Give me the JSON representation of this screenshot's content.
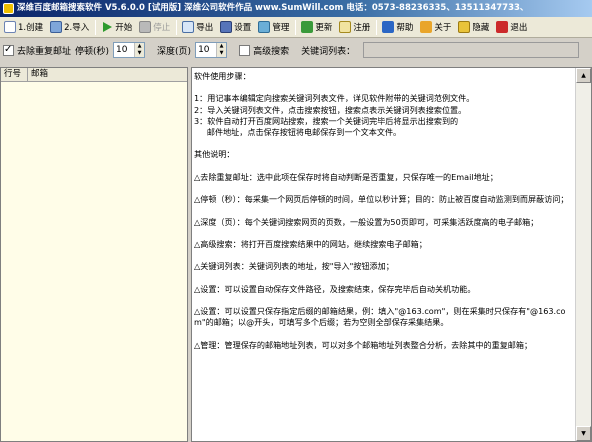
{
  "window": {
    "title": "深维百度邮箱搜索软件 V5.6.0.0 [试用版] 深维公司软件作品 www.SumWill.com 电话：0573-88236335、13511347733、"
  },
  "toolbar": {
    "items": [
      {
        "label": "1.创建",
        "icon": "new-file-icon",
        "enabled": true
      },
      {
        "label": "2.导入",
        "icon": "import-icon",
        "enabled": true
      },
      {
        "label": "开始",
        "icon": "play-icon",
        "enabled": true
      },
      {
        "label": "停止",
        "icon": "stop-icon",
        "enabled": false
      },
      {
        "label": "导出",
        "icon": "export-icon",
        "enabled": true
      },
      {
        "label": "设置",
        "icon": "save-settings-icon",
        "enabled": true
      },
      {
        "label": "管理",
        "icon": "manage-icon",
        "enabled": true
      },
      {
        "label": "更新",
        "icon": "refresh-icon",
        "enabled": true
      },
      {
        "label": "注册",
        "icon": "register-icon",
        "enabled": true
      },
      {
        "label": "帮助",
        "icon": "help-icon",
        "enabled": true
      },
      {
        "label": "关于",
        "icon": "info-icon",
        "enabled": true
      },
      {
        "label": "隐藏",
        "icon": "hide-icon",
        "enabled": true
      },
      {
        "label": "退出",
        "icon": "exit-icon",
        "enabled": true
      }
    ]
  },
  "options": {
    "dedupe_label": "去除重复邮址",
    "dedupe_checked": true,
    "delay_label": "停顿(秒)",
    "delay_value": "10",
    "depth_label": "深度(页)",
    "depth_value": "10",
    "advanced_label": "高级搜索",
    "advanced_checked": false,
    "keyword_list_label": "关键词列表：",
    "keyword_list_value": ""
  },
  "left_table": {
    "columns": [
      "行号",
      "邮箱"
    ]
  },
  "instructions": {
    "text": "软件使用步骤：\n\n1：用记事本编辑定向搜索关键词列表文件，详见软件附带的关键词范例文件。\n2：导入关键词列表文件，点击搜索按钮，搜索点表示关键词列表搜索位置。\n3：软件自动打开百度网站搜索，搜索一个关键词完毕后将显示出搜索到的\n     邮件地址，点击保存按钮将电邮保存到一个文本文件。\n\n其他说明：\n\n△去除重复邮址：选中此项在保存时将自动判断是否重复，只保存唯一的Email地址；\n\n△停顿（秒）：每采集一个网页后停顿的时间，单位以秒计算；目的：防止被百度自动监测到而屏蔽访问；\n\n△深度（页）：每个关键词搜索网页的页数，一般设置为50页即可，可采集活跃度高的电子邮箱；\n\n△高级搜索：将打开百度搜索结果中的网站，继续搜索电子邮箱；\n\n△关键词列表：关键词列表的地址，按\"导入\"按钮添加；\n\n△设置：可以设置自动保存文件路径，及搜索结束，保存完毕后自动关机功能。\n\n△设置：可以设置只保存指定后缀的邮箱结果，例：填入\"@163.com\"，则在采集时只保存有\"@163.com\"的邮箱；以@开头，可填写多个后缀；若为空则全部保存采集结果。\n\n△管理：管理保存的邮箱地址列表，可以对多个邮箱地址列表整合分析，去除其中的重复邮箱；"
  }
}
